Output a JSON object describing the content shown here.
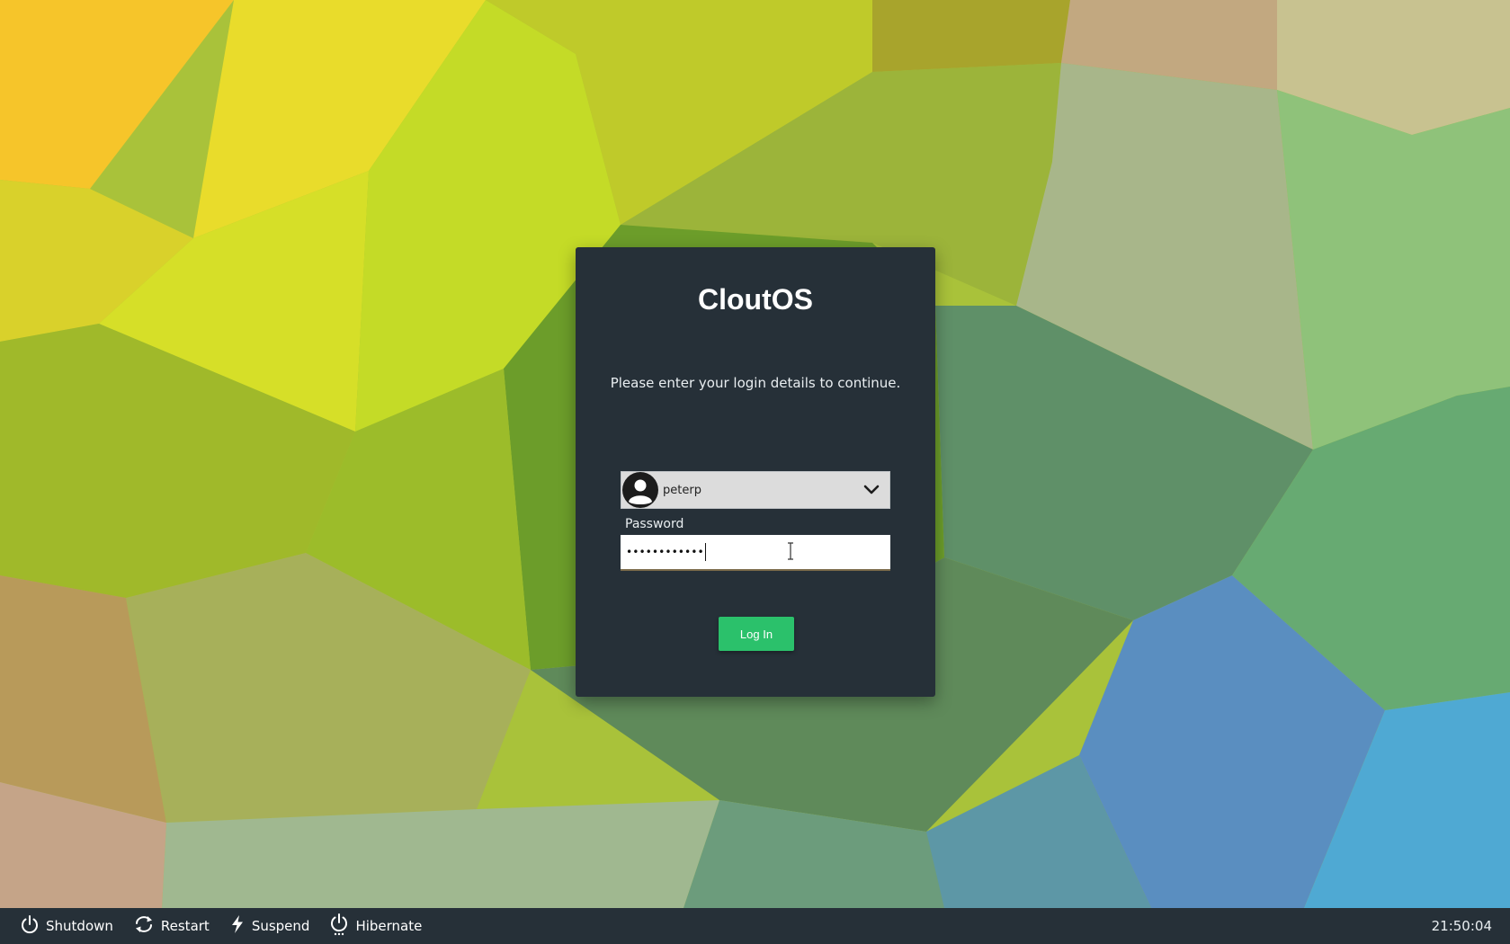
{
  "login": {
    "brand": "CloutOS",
    "prompt": "Please enter your login details to continue.",
    "user": {
      "selected": "peterp",
      "avatar_icon": "user-avatar-icon",
      "dropdown_icon": "chevron-down-icon"
    },
    "password": {
      "label": "Password",
      "masked_value": "••••••••••••"
    },
    "login_label": "Log In",
    "accent_color": "#2bc16b",
    "panel_color": "#263038"
  },
  "taskbar": {
    "actions": [
      {
        "label": "Shutdown",
        "icon": "power-icon"
      },
      {
        "label": "Restart",
        "icon": "restart-icon"
      },
      {
        "label": "Suspend",
        "icon": "lightning-icon"
      },
      {
        "label": "Hibernate",
        "icon": "hibernate-icon"
      }
    ],
    "clock": "21:50:04"
  }
}
